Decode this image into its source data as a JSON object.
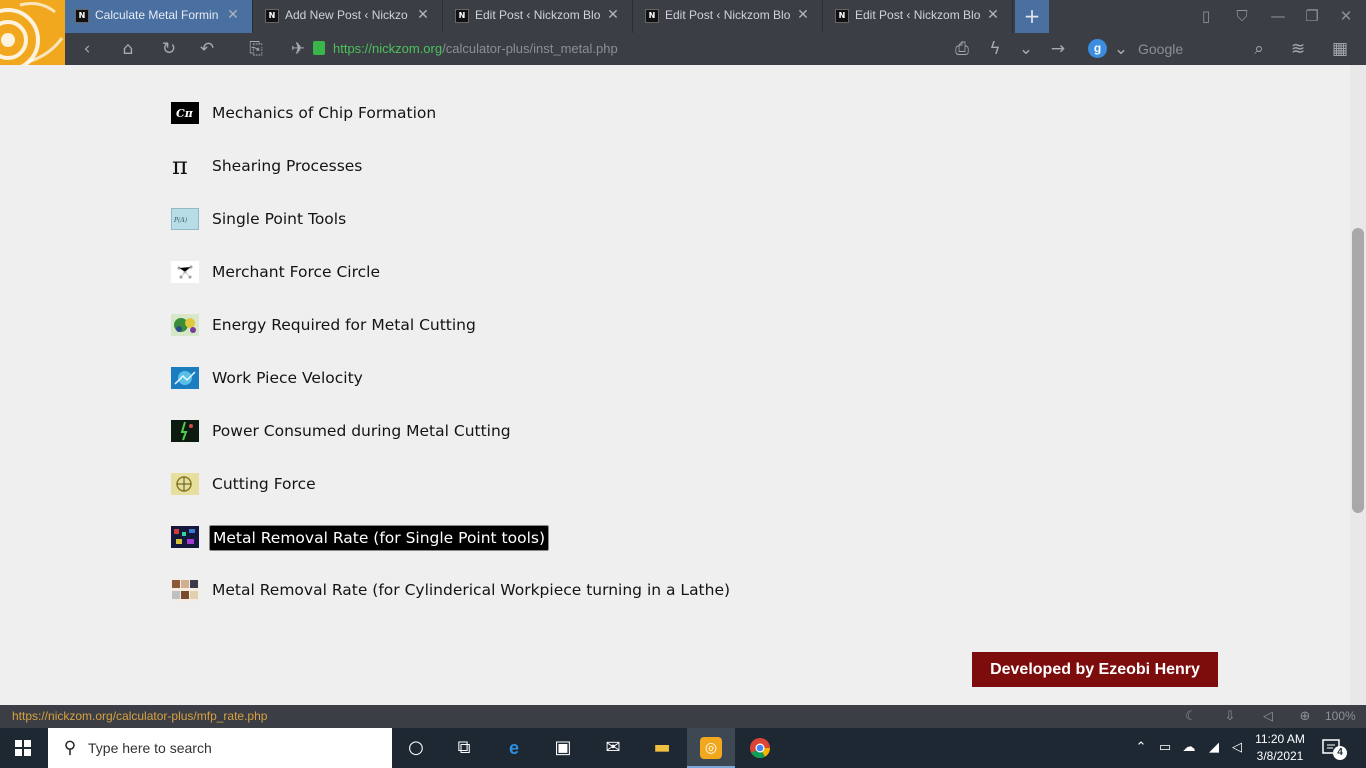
{
  "browser": {
    "tabs": [
      {
        "title": "Calculate Metal Formin",
        "active": true
      },
      {
        "title": "Add New Post ‹ Nickzo",
        "active": false
      },
      {
        "title": "Edit Post ‹ Nickzom Blo",
        "active": false
      },
      {
        "title": "Edit Post ‹ Nickzom Blo",
        "active": false
      },
      {
        "title": "Edit Post ‹ Nickzom Blo",
        "active": false
      }
    ],
    "url_host": "https://nickzom.org",
    "url_path": "/calculator-plus/inst_metal.php",
    "search_placeholder": "Google",
    "search_engine_icon": "g",
    "status_url": "https://nickzom.org/calculator-plus/mfp_rate.php",
    "zoom": "100%",
    "accent": "#4a6fa1"
  },
  "calculators": [
    {
      "label": "Mechanics of Chip Formation",
      "icon": "chip-formation-thumbnail",
      "highlighted": false
    },
    {
      "label": "Shearing Processes",
      "icon": "pi-thumbnail",
      "highlighted": false
    },
    {
      "label": "Single Point Tools",
      "icon": "single-point-tools-thumbnail",
      "highlighted": false
    },
    {
      "label": "Merchant Force Circle",
      "icon": "force-circle-thumbnail",
      "highlighted": false
    },
    {
      "label": "Energy Required for Metal Cutting",
      "icon": "energy-thumbnail",
      "highlighted": false
    },
    {
      "label": "Work Piece Velocity",
      "icon": "velocity-thumbnail",
      "highlighted": false
    },
    {
      "label": "Power Consumed during Metal Cutting",
      "icon": "power-thumbnail",
      "highlighted": false
    },
    {
      "label": "Cutting Force",
      "icon": "cutting-force-thumbnail",
      "highlighted": false
    },
    {
      "label": "Metal Removal Rate (for Single Point tools)",
      "icon": "removal-rate-thumbnail",
      "highlighted": true
    },
    {
      "label": "Metal Removal Rate (for Cylinderical Workpiece turning in a Lathe)",
      "icon": "lathe-thumbnail",
      "highlighted": false
    }
  ],
  "credit": {
    "label": "Developed by Ezeobi Henry",
    "color": "#7d0c0c"
  },
  "taskbar": {
    "search_placeholder": "Type here to search",
    "time": "11:20 AM",
    "date": "3/8/2021",
    "notification_count": "4"
  }
}
